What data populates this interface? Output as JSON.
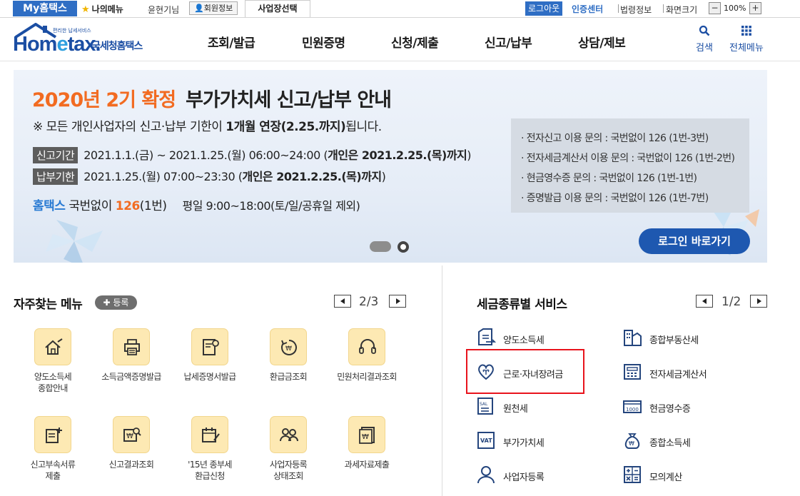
{
  "topbar": {
    "my_hometax": "My홈택스",
    "my_menu": "나의메뉴",
    "user_greeting": "윤현기님",
    "member_info": "회원정보",
    "biz_select": "사업장선택",
    "logout": "로그아웃",
    "cert_center": "인증센터",
    "law_info": "법령정보",
    "screen_size": "화면크기",
    "zoom": "100%",
    "zoom_minus": "−",
    "zoom_plus": "+"
  },
  "header": {
    "logo_word_a": "Hom",
    "logo_word_b": "e",
    "logo_word_c": "tax.",
    "logo_sub": "국세청홈택스",
    "logo_tag": "편리한 납세서비스",
    "nav": [
      "조회/발급",
      "민원증명",
      "신청/제출",
      "신고/납부",
      "상담/제보"
    ],
    "search": "검색",
    "all_menu": "전체메뉴"
  },
  "banner": {
    "title_orange": "2020년 2기 확정",
    "title_dark": "부가가치세 신고/납부 안내",
    "notice_a": "※ 모든 개인사업자의 신고·납부 기한이 ",
    "notice_b": "1개월 연장(2.25.까지)",
    "notice_c": "됩니다.",
    "row1_tag": "신고기간",
    "row1_text": "2021.1.1.(금) ~ 2021.1.25.(월) 06:00~24:00 (",
    "row1_bold": "개인은 2021.2.25.(목)까지",
    "row1_end": ")",
    "row2_tag": "납부기한",
    "row2_text": "2021.1.25.(월) 07:00~23:30 (",
    "row2_bold": "개인은 2021.2.25.(목)까지",
    "row2_end": ")",
    "ht_name": "홈택스",
    "ht_a": " 국번없이 ",
    "ht_num": "126",
    "ht_b": "(1번)",
    "ht_hours": "평일 9:00~18:00(토/일/공휴일 제외)",
    "info": [
      "· 전자신고 이용 문의 : 국번없이 126 (1번-3번)",
      "· 전자세금계산서 이용 문의 : 국번없이 126 (1번-2번)",
      "· 현금영수증 문의 : 국번없이 126 (1번-1번)",
      "· 증명발급 이용 문의 : 국번없이 126 (1번-7번)"
    ],
    "login_button": "로그인 바로가기"
  },
  "favorites": {
    "title": "자주찾는 메뉴",
    "register": "✚ 등록",
    "page": "2/3",
    "items": [
      {
        "label": "양도소득세\n종합안내",
        "icon": "house-pen-icon"
      },
      {
        "label": "소득금액증명발급",
        "icon": "printer-icon"
      },
      {
        "label": "납세증명서발급",
        "icon": "certificate-icon"
      },
      {
        "label": "환급금조회",
        "icon": "refund-won-icon"
      },
      {
        "label": "민원처리결과조회",
        "icon": "headset-icon"
      },
      {
        "label": "신고부속서류\n제출",
        "icon": "document-add-icon"
      },
      {
        "label": "신고결과조회",
        "icon": "won-search-icon"
      },
      {
        "label": "'15년 종부세\n환급신청",
        "icon": "calendar-pen-icon"
      },
      {
        "label": "사업자등록\n상태조회",
        "icon": "users-search-icon"
      },
      {
        "label": "과세자료제출",
        "icon": "won-document-icon"
      }
    ]
  },
  "tax_services": {
    "title": "세금종류별 서비스",
    "page": "1/2",
    "left": [
      {
        "label": "양도소득세",
        "icon": "transfer-document-icon"
      },
      {
        "label": "근로·자녀장려금",
        "icon": "heart-sprout-icon"
      },
      {
        "label": "원천세",
        "icon": "withholding-icon"
      },
      {
        "label": "부가가치세",
        "icon": "vat-icon"
      },
      {
        "label": "사업자등록",
        "icon": "user-icon"
      }
    ],
    "right": [
      {
        "label": "종합부동산세",
        "icon": "building-icon"
      },
      {
        "label": "전자세금계산서",
        "icon": "invoice-icon"
      },
      {
        "label": "현금영수증",
        "icon": "cash-receipt-icon"
      },
      {
        "label": "종합소득세",
        "icon": "money-bag-icon"
      },
      {
        "label": "모의계산",
        "icon": "calculator-icon"
      }
    ]
  },
  "colors": {
    "brand_blue": "#1e58b0",
    "accent_orange": "#f26b21",
    "highlight_red": "#e8131c"
  }
}
